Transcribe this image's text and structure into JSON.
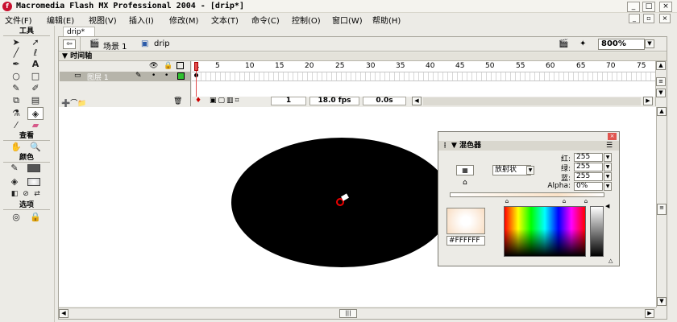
{
  "window": {
    "title": "Macromedia Flash MX Professional 2004 - [drip*]",
    "minimize": "_",
    "maximize": "□",
    "close": "×"
  },
  "menu": [
    "文件(F)",
    "编辑(E)",
    "视图(V)",
    "插入(I)",
    "修改(M)",
    "文本(T)",
    "命令(C)",
    "控制(O)",
    "窗口(W)",
    "帮助(H)"
  ],
  "toolbox": {
    "tools_label": "工具",
    "view_label": "查看",
    "colors_label": "颜色",
    "options_label": "选项"
  },
  "document": {
    "tab": "drip*",
    "scene": "场景 1",
    "symbol": "drip",
    "zoom": "800%"
  },
  "timeline": {
    "panel_title": "时间轴",
    "layer_name": "图层 1",
    "ruler": [
      "1",
      "5",
      "10",
      "15",
      "20",
      "25",
      "30",
      "35",
      "40",
      "45",
      "50",
      "55",
      "60",
      "65",
      "70",
      "75"
    ],
    "current_frame": "1",
    "fps": "18.0 fps",
    "elapsed": "0.0s"
  },
  "mixer": {
    "title": "混色器",
    "fill_type": "放射状",
    "red_label": "红:",
    "green_label": "绿:",
    "blue_label": "蓝:",
    "alpha_label": "Alpha:",
    "red": "255",
    "green": "255",
    "blue": "255",
    "alpha": "0%",
    "hex": "#FFFFFF"
  },
  "colors": {
    "accent": "#e14b4b",
    "panel": "#ecebe6",
    "stage": "#ffffff",
    "shape": "#000000"
  }
}
